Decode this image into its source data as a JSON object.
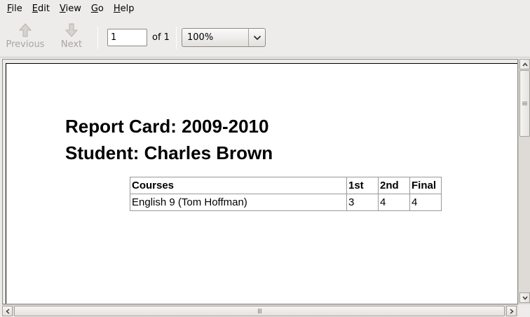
{
  "menu": [
    {
      "mnemonic": "F",
      "rest": "ile"
    },
    {
      "mnemonic": "E",
      "rest": "dit"
    },
    {
      "mnemonic": "V",
      "rest": "iew"
    },
    {
      "mnemonic": "G",
      "rest": "o"
    },
    {
      "mnemonic": "H",
      "rest": "elp"
    }
  ],
  "toolbar": {
    "previous_label": "Previous",
    "next_label": "Next",
    "page_value": "1",
    "page_of": "of 1",
    "zoom_value": "100%"
  },
  "document": {
    "title": "Report Card: 2009-2010",
    "student": "Student: Charles Brown",
    "table": {
      "headers": [
        "Courses",
        "1st",
        "2nd",
        "Final"
      ],
      "rows": [
        [
          "English 9 (Tom Hoffman)",
          "3",
          "4",
          "4"
        ]
      ]
    }
  },
  "colors": {
    "window_bg": "#edeceb",
    "disabled_text": "#a9a6a0"
  },
  "icons": {
    "previous": "up-arrow-icon",
    "next": "down-arrow-icon",
    "zoom_dropdown": "chevron-down-icon"
  }
}
